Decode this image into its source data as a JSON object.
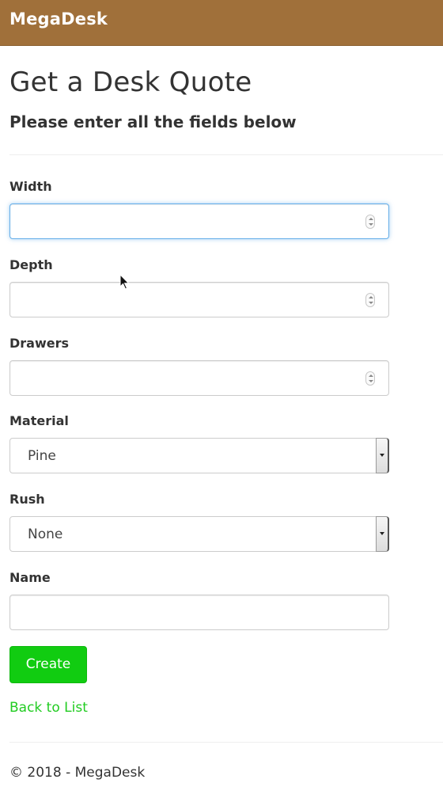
{
  "navbar": {
    "brand": "MegaDesk"
  },
  "page": {
    "title": "Get a Desk Quote",
    "subtitle": "Please enter all the fields below"
  },
  "form": {
    "width": {
      "label": "Width",
      "value": "",
      "focused": true
    },
    "depth": {
      "label": "Depth",
      "value": ""
    },
    "drawers": {
      "label": "Drawers",
      "value": ""
    },
    "material": {
      "label": "Material",
      "selected": "Pine"
    },
    "rush": {
      "label": "Rush",
      "selected": "None"
    },
    "name": {
      "label": "Name",
      "value": ""
    },
    "submit_label": "Create"
  },
  "links": {
    "back_to_list": "Back to List"
  },
  "footer": {
    "text": "© 2018 - MegaDesk"
  },
  "colors": {
    "navbar": "#a0703a",
    "primary_button": "#11cc11",
    "link": "#22cc22",
    "focus_ring": "#66afe9"
  },
  "icons": {
    "number_spinner": "spinner-icon",
    "select_arrow": "chevron-down-icon",
    "mouse_cursor": "cursor-icon"
  }
}
